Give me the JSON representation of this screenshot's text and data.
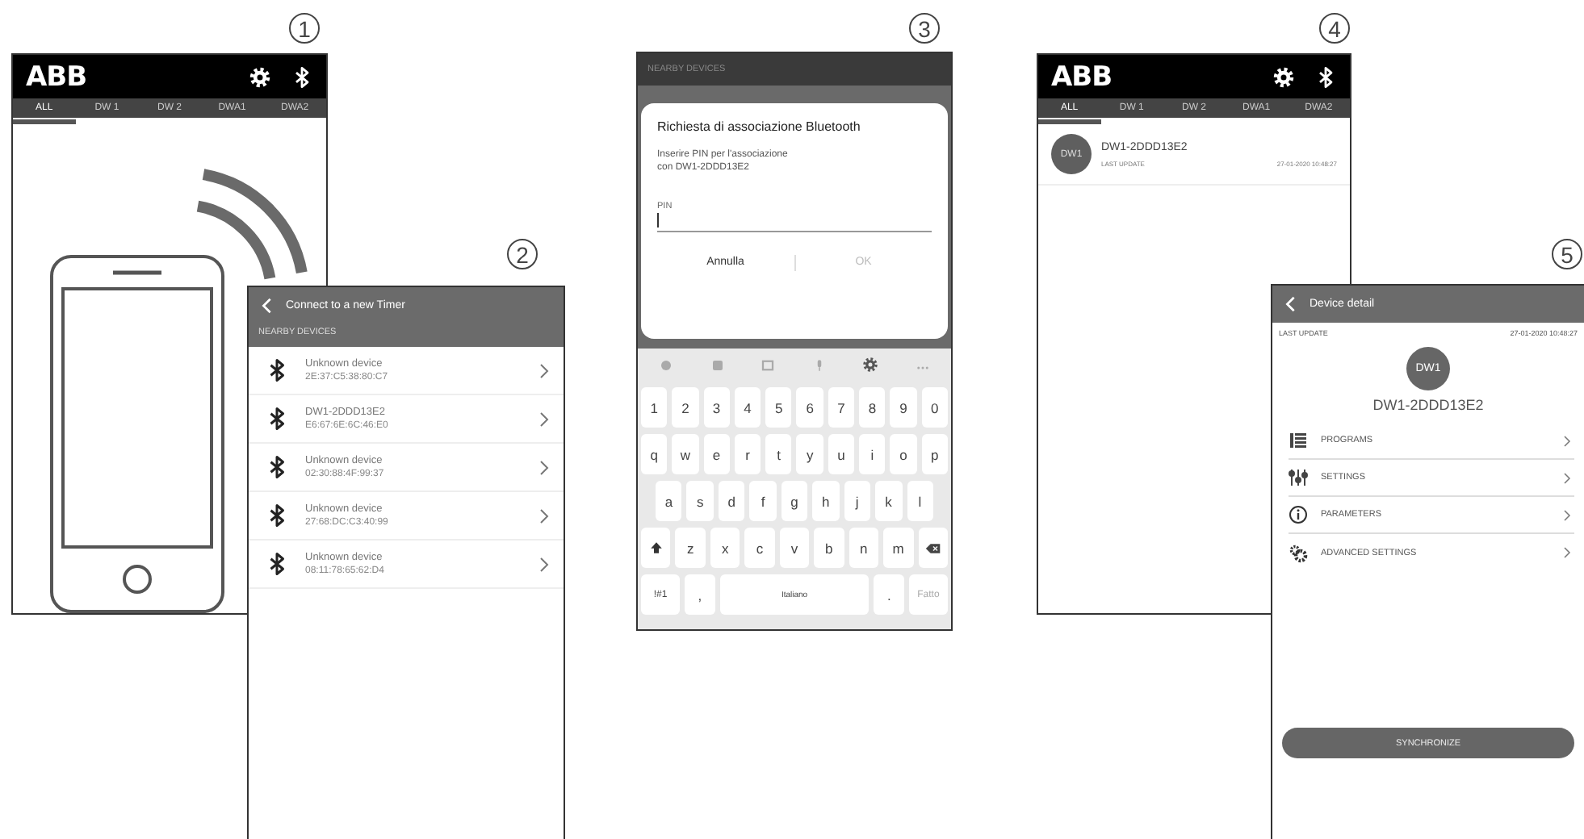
{
  "steps": [
    {
      "number": "1",
      "kind": "home",
      "logo": "ABB",
      "tabs": [
        {
          "label": "ALL",
          "selected": true
        },
        {
          "label": "DW 1",
          "selected": false
        },
        {
          "label": "DW 2",
          "selected": false
        },
        {
          "label": "DWA1",
          "selected": false
        },
        {
          "label": "DWA2",
          "selected": false
        }
      ]
    },
    {
      "number": "2",
      "kind": "scan",
      "title": "Connect to a new Timer",
      "section": "NEARBY DEVICES",
      "devices": [
        {
          "name": "Unknown device",
          "address": "2E:37:C5:38:80:C7"
        },
        {
          "name": "DW1-2DDD13E2",
          "address": "E6:67:6E:6C:46:E0"
        },
        {
          "name": "Unknown device",
          "address": "02:30:88:4F:99:37"
        },
        {
          "name": "Unknown device",
          "address": "27:68:DC:C3:40:99"
        },
        {
          "name": "Unknown device",
          "address": "08:11:78:65:62:D4"
        }
      ]
    },
    {
      "number": "3",
      "kind": "pairing",
      "section": "NEARBY DEVICES",
      "dialog": {
        "title": "Richiesta di associazione Bluetooth",
        "message": "Inserire PIN per l'associazione\ncon DW1-2DDD13E2",
        "field_label": "PIN",
        "buttons": [
          {
            "label": "Annulla",
            "disabled": false
          },
          {
            "label": "OK",
            "disabled": true
          }
        ]
      },
      "keyboard": {
        "rows": [
          {
            "keys": [
              {
                "kind": "char",
                "label": "1"
              },
              {
                "kind": "char",
                "label": "2"
              },
              {
                "kind": "char",
                "label": "3"
              },
              {
                "kind": "char",
                "label": "4"
              },
              {
                "kind": "char",
                "label": "5"
              },
              {
                "kind": "char",
                "label": "6"
              },
              {
                "kind": "char",
                "label": "7"
              },
              {
                "kind": "char",
                "label": "8"
              },
              {
                "kind": "char",
                "label": "9"
              },
              {
                "kind": "char",
                "label": "0"
              }
            ]
          },
          {
            "keys": [
              {
                "kind": "char",
                "label": "q"
              },
              {
                "kind": "char",
                "label": "w"
              },
              {
                "kind": "char",
                "label": "e"
              },
              {
                "kind": "char",
                "label": "r"
              },
              {
                "kind": "char",
                "label": "t"
              },
              {
                "kind": "char",
                "label": "y"
              },
              {
                "kind": "char",
                "label": "u"
              },
              {
                "kind": "char",
                "label": "i"
              },
              {
                "kind": "char",
                "label": "o"
              },
              {
                "kind": "char",
                "label": "p"
              }
            ]
          },
          {
            "keys": [
              {
                "kind": "char",
                "label": "a"
              },
              {
                "kind": "char",
                "label": "s"
              },
              {
                "kind": "char",
                "label": "d"
              },
              {
                "kind": "char",
                "label": "f"
              },
              {
                "kind": "char",
                "label": "g"
              },
              {
                "kind": "char",
                "label": "h"
              },
              {
                "kind": "char",
                "label": "j"
              },
              {
                "kind": "char",
                "label": "k"
              },
              {
                "kind": "char",
                "label": "l"
              }
            ]
          },
          {
            "keys": [
              {
                "kind": "shift"
              },
              {
                "kind": "char",
                "label": "z"
              },
              {
                "kind": "char",
                "label": "x"
              },
              {
                "kind": "char",
                "label": "c"
              },
              {
                "kind": "char",
                "label": "v"
              },
              {
                "kind": "char",
                "label": "b"
              },
              {
                "kind": "char",
                "label": "n"
              },
              {
                "kind": "char",
                "label": "m"
              },
              {
                "kind": "backspace"
              }
            ]
          },
          {
            "keys": [
              {
                "kind": "mode",
                "label": "!#1"
              },
              {
                "kind": "char",
                "label": ","
              },
              {
                "kind": "space",
                "label": "Italiano"
              },
              {
                "kind": "char",
                "label": "."
              },
              {
                "kind": "done",
                "label": "Fatto"
              }
            ]
          }
        ]
      }
    },
    {
      "number": "4",
      "kind": "device_list",
      "logo": "ABB",
      "tabs": [
        {
          "label": "ALL",
          "selected": true
        },
        {
          "label": "DW 1",
          "selected": false
        },
        {
          "label": "DW 2",
          "selected": false
        },
        {
          "label": "DWA1",
          "selected": false
        },
        {
          "label": "DWA2",
          "selected": false
        }
      ],
      "devices": [
        {
          "badge": "DW1",
          "name": "DW1-2DDD13E2",
          "update_label": "LAST UPDATE",
          "update_time": "27-01-2020 10:48:27"
        }
      ]
    },
    {
      "number": "5",
      "kind": "detail",
      "title": "Device detail",
      "update_label": "LAST UPDATE",
      "update_time": "27-01-2020 10:48:27",
      "badge": "DW1",
      "device_name": "DW1-2DDD13E2",
      "menu": [
        {
          "label": "PROGRAMS",
          "kind": "list"
        },
        {
          "label": "SETTINGS",
          "kind": "sliders"
        },
        {
          "label": "PARAMETERS",
          "kind": "info"
        },
        {
          "label": "ADVANCED SETTINGS",
          "kind": "gears"
        }
      ],
      "button": "SYNCHRONIZE"
    }
  ]
}
